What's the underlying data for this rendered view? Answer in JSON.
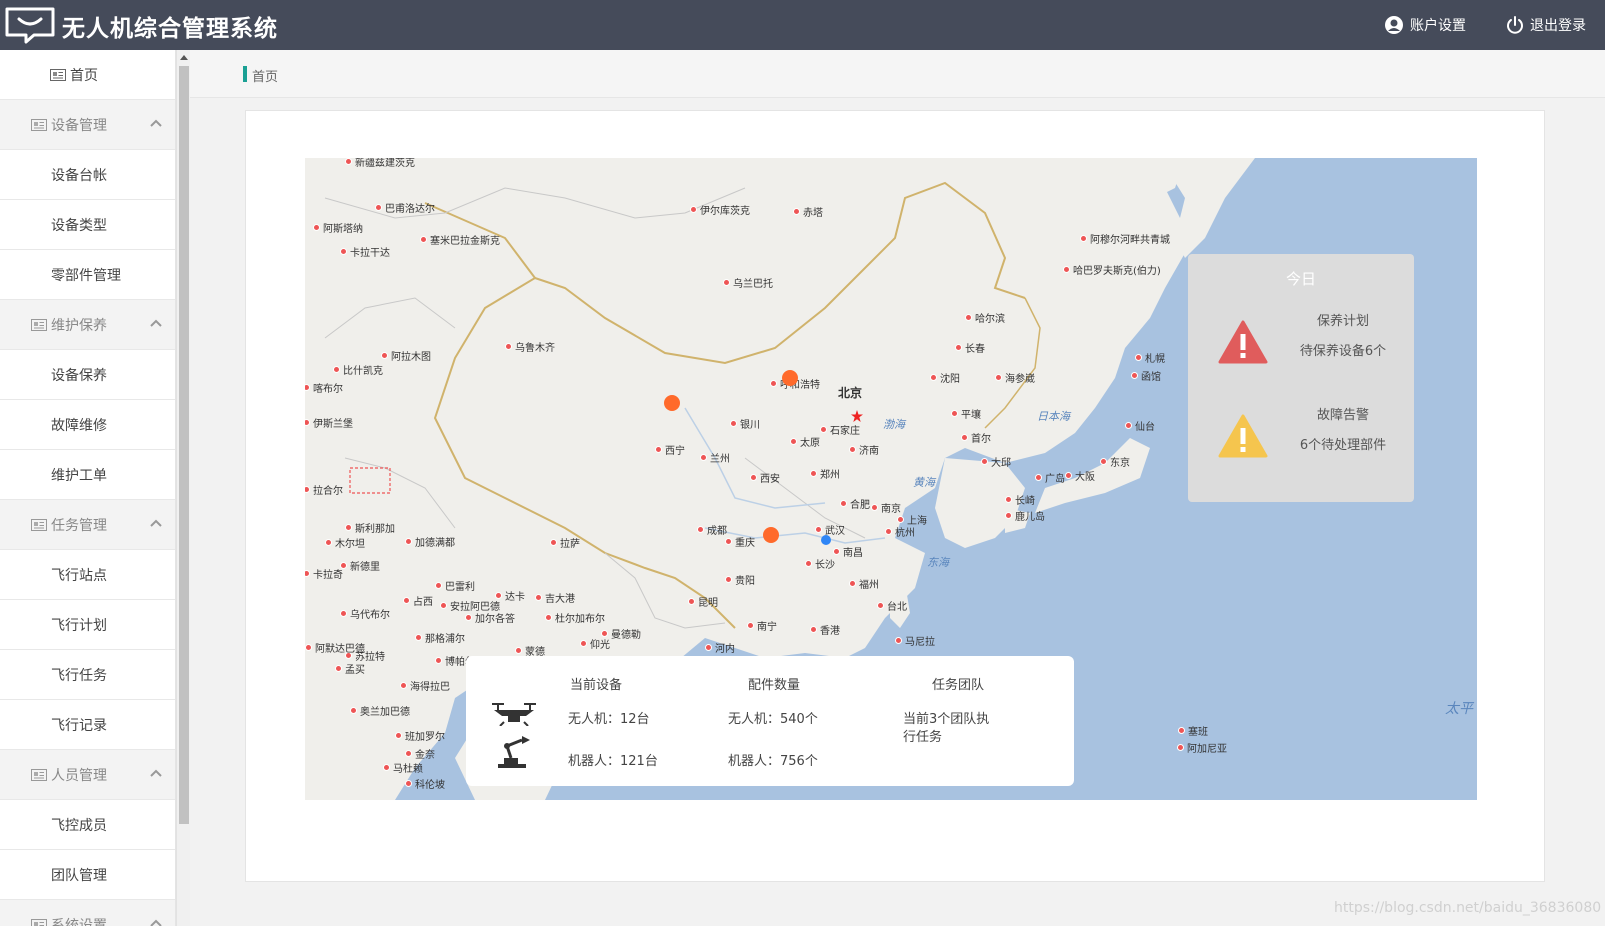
{
  "header": {
    "title": "无人机综合管理系统",
    "account_label": "账户设置",
    "logout_label": "退出登录"
  },
  "sidebar": {
    "home": "首页",
    "groups": [
      {
        "label": "设备管理",
        "items": [
          "设备台帐",
          "设备类型",
          "零部件管理"
        ]
      },
      {
        "label": "维护保养",
        "items": [
          "设备保养",
          "故障维修",
          "维护工单"
        ]
      },
      {
        "label": "任务管理",
        "items": [
          "飞行站点",
          "飞行计划",
          "飞行任务",
          "飞行记录"
        ]
      },
      {
        "label": "人员管理",
        "items": [
          "飞控成员",
          "团队管理"
        ]
      },
      {
        "label": "系统设置",
        "items": []
      }
    ]
  },
  "breadcrumb": "首页",
  "today": {
    "title": "今日",
    "alerts": [
      {
        "icon": "danger-triangle-icon",
        "color": "#e05c5c",
        "title": "保养计划",
        "desc": "待保养设备6个"
      },
      {
        "icon": "warning-triangle-icon",
        "color": "#f5c54e",
        "title": "故障告警",
        "desc": "6个待处理部件"
      }
    ]
  },
  "stats": {
    "headers": [
      "当前设备",
      "配件数量",
      "任务团队"
    ],
    "device_drone": "无人机：12台",
    "device_robot": "机器人：121台",
    "parts_drone": "无人机：540个",
    "parts_robot": "机器人：756个",
    "team_line1": "当前3个团队执",
    "team_line2": "行任务"
  },
  "map": {
    "cities": [
      "新疆兹建茨克",
      "巴甫洛达尔",
      "伊尔库茨克",
      "赤塔",
      "阿斯塔纳",
      "塞米巴拉金斯克",
      "卡拉干达",
      "乌兰巴托",
      "阿穆尔河畔共青城",
      "哈巴罗夫斯克(伯力)",
      "哈尔滨",
      "乌鲁木齐",
      "阿拉木图",
      "比什凯克",
      "长春",
      "呼和浩特",
      "北京",
      "沈阳",
      "海参崴",
      "札幌",
      "函馆",
      "银川",
      "太原",
      "石家庄",
      "平壤",
      "首尔",
      "仙台",
      "西宁",
      "兰州",
      "济南",
      "大邱",
      "西安",
      "郑州",
      "广岛",
      "大阪",
      "东京",
      "合肥",
      "南京",
      "长崎",
      "鹿儿岛",
      "成都",
      "重庆",
      "武汉",
      "杭州",
      "上海",
      "拉萨",
      "新德里",
      "南昌",
      "长沙",
      "贵阳",
      "福州",
      "昆明",
      "台北",
      "南宁",
      "香港",
      "曼德勒",
      "加尔各答",
      "河内",
      "海得拉巴",
      "班加罗尔",
      "孟买",
      "马尼拉",
      "加德满都",
      "喀布尔",
      "伊斯兰堡",
      "拉合尔",
      "达卡",
      "吉大港",
      "仰光",
      "塞班",
      "阿加尼亚",
      "斯利那加",
      "木尔坦",
      "卡拉奇",
      "乌代布尔",
      "占西",
      "安拉阿巴德",
      "那格浦尔",
      "博帕尔",
      "苏拉特",
      "奥兰加巴德",
      "阿默达巴德",
      "巴雷利",
      "杜尔加布尔",
      "蒙德",
      "科伦坡",
      "马杜赖",
      "金奈"
    ],
    "seas": [
      "渤海",
      "黄海",
      "东海",
      "日本海",
      "太平"
    ],
    "markers": [
      "orange",
      "orange",
      "orange",
      "blue"
    ]
  },
  "watermark": "https://blog.csdn.net/baidu_36836080"
}
